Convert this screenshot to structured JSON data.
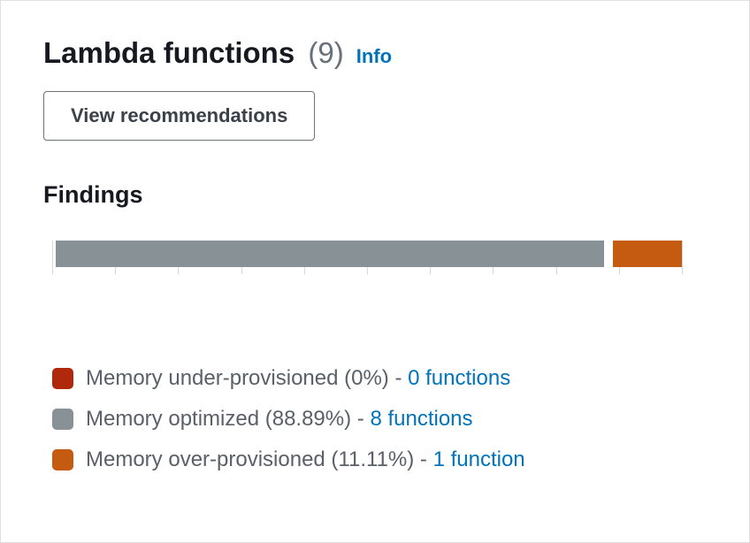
{
  "header": {
    "title": "Lambda functions",
    "count_display": "(9)",
    "info_label": "Info"
  },
  "actions": {
    "view_recommendations": "View recommendations"
  },
  "findings": {
    "title": "Findings",
    "bar": {
      "ticks": 10,
      "segments": [
        {
          "key": "optimized",
          "percent": 88.89
        },
        {
          "key": "over",
          "percent": 11.11
        }
      ]
    },
    "legend": [
      {
        "key": "under",
        "label": "Memory under-provisioned (0%) - ",
        "link": "0 functions"
      },
      {
        "key": "optimized",
        "label": "Memory optimized (88.89%) - ",
        "link": "8 functions"
      },
      {
        "key": "over",
        "label": "Memory over-provisioned (11.11%) - ",
        "link": "1 function"
      }
    ]
  },
  "chart_data": {
    "type": "bar",
    "title": "Findings",
    "categories": [
      "Memory under-provisioned",
      "Memory optimized",
      "Memory over-provisioned"
    ],
    "series": [
      {
        "name": "Functions",
        "values": [
          0,
          8,
          1
        ]
      },
      {
        "name": "Percent",
        "values": [
          0,
          88.89,
          11.11
        ]
      }
    ],
    "total": 9,
    "xlabel": "",
    "ylabel": "",
    "ylim": [
      0,
      100
    ],
    "colors": {
      "Memory under-provisioned": "#b0290c",
      "Memory optimized": "#879196",
      "Memory over-provisioned": "#c55a11"
    }
  }
}
